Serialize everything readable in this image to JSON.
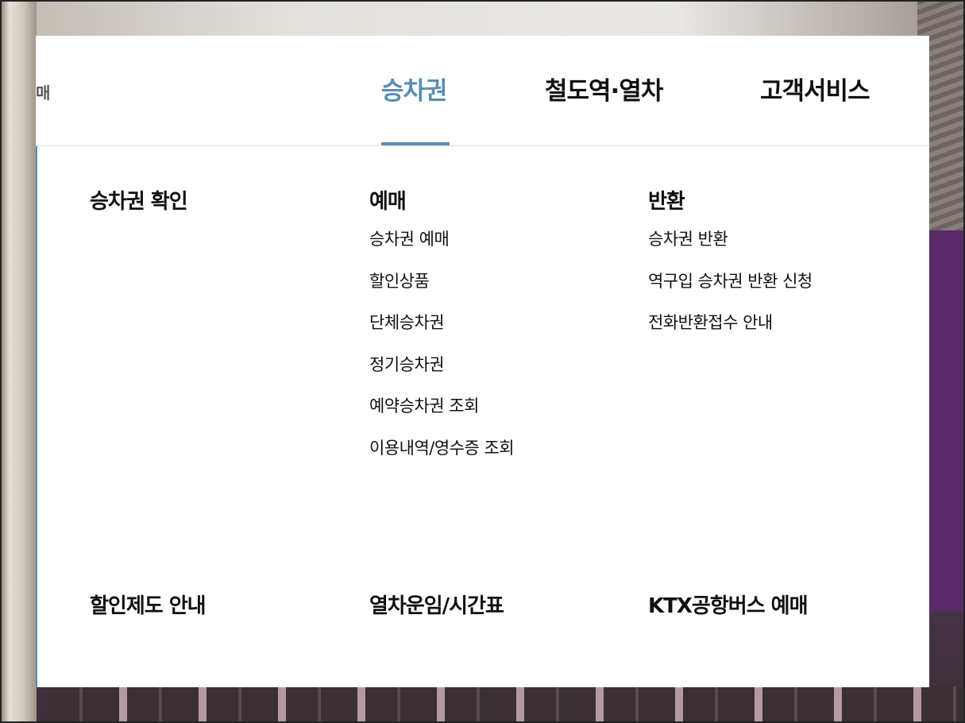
{
  "nav": {
    "cut_label": "매",
    "tabs": [
      {
        "label": "승차권",
        "active": true
      },
      {
        "label": "철도역·열차",
        "active": false
      },
      {
        "label": "고객서비스",
        "active": false
      }
    ],
    "accent_color": "#5a8db3"
  },
  "menu": {
    "col1": {
      "heading": "승차권 확인",
      "items": []
    },
    "col2": {
      "heading": "예매",
      "items": [
        "승차권 예매",
        "할인상품",
        "단체승차권",
        "정기승차권",
        "예약승차권 조회",
        "이용내역/영수증 조회"
      ]
    },
    "col3": {
      "heading": "반환",
      "items": [
        "승차권 반환",
        "역구입 승차권 반환 신청",
        "전화반환접수 안내"
      ]
    },
    "bottom": [
      "할인제도 안내",
      "열차운임/시간표",
      "KTX공항버스 예매"
    ]
  }
}
